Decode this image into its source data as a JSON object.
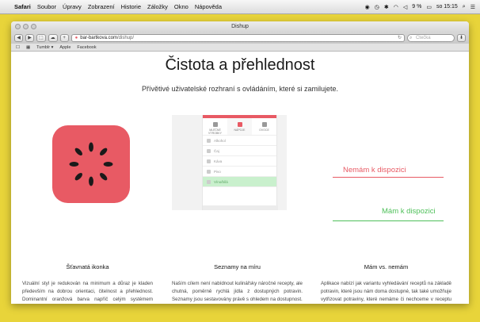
{
  "menubar": {
    "app": "Safari",
    "items": [
      "Soubor",
      "Úpravy",
      "Zobrazení",
      "Historie",
      "Záložky",
      "Okno",
      "Nápověda"
    ],
    "battery": "9 %",
    "clock": "so 15:15"
  },
  "window": {
    "title": "Dishup",
    "url_host": "bar-bartkova.com",
    "url_path": "/dishup/",
    "reader_label": "Čtečka",
    "bookmarks": [
      "Tumblr ▾",
      "Apple",
      "Facebook"
    ]
  },
  "page": {
    "title": "Čistota a přehlednost",
    "subtitle": "Přívětivé uživatelské rozhraní s ovládáním, které si zamilujete.",
    "phone": {
      "tabs": [
        "MLÉČNÉ VÝROBKY",
        "NÁPOJE",
        "OVOCE"
      ],
      "rows": [
        "Alkohol",
        "Čaj",
        "Káva",
        "Pivo",
        "Víno/bílá"
      ]
    },
    "demo": {
      "unavailable": "Nemám k dispozici",
      "available": "Mám k dispozici",
      "unavailable_color": "#e85a64",
      "available_color": "#4fc05a"
    },
    "columns": [
      {
        "title": "Šťavnatá ikonka",
        "text": "Vizuální styl je redukován na minimum a důraz je kladen především na dobrou orientaci, čitelnost a přehlednost. Dominantní oranžová barva napříč celým systémem evokuje chuť k jídlu."
      },
      {
        "title": "Seznamy na míru",
        "text": "Naším cílem není nabídnout kulinářsky náročné recepty, ale chutná, poměrně rychlá jídla z dostupných potravin. Seznamy jsou sestavovány právě s ohledem na dostupnost."
      },
      {
        "title": "Mám vs. nemám",
        "text": "Aplikace nabízí jak variantu vyhledávání receptů na základě potravin, které jsou nám doma dostupné, tak také umožňuje vytřizovat potraviny, které nemáme či nechceme v receptu použít."
      }
    ]
  },
  "colors": {
    "accent": "#e85a64",
    "desktop": "#e8d43a"
  }
}
